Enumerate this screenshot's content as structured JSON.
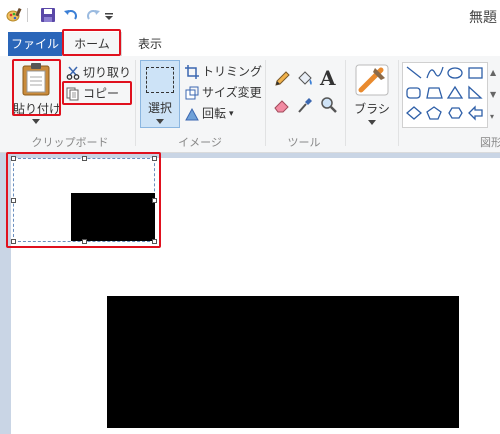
{
  "app": {
    "title": "無題"
  },
  "tabs": {
    "file": "ファイル",
    "home": "ホーム",
    "view": "表示"
  },
  "clipboard": {
    "paste_label": "貼り付け",
    "cut_label": "切り取り",
    "copy_label": "コピー",
    "group_label": "クリップボード"
  },
  "image": {
    "select_label": "選択",
    "crop_label": "トリミング",
    "resize_label": "サイズ変更",
    "rotate_label": "回転",
    "group_label": "イメージ"
  },
  "tools": {
    "group_label": "ツール",
    "text_glyph": "A"
  },
  "brushes": {
    "label": "ブラシ"
  },
  "shapes": {
    "group_label": "図形"
  },
  "colors": {
    "accent": "#2a66b9",
    "highlight": "#e0111e",
    "workspace": "#c9d5e5"
  }
}
